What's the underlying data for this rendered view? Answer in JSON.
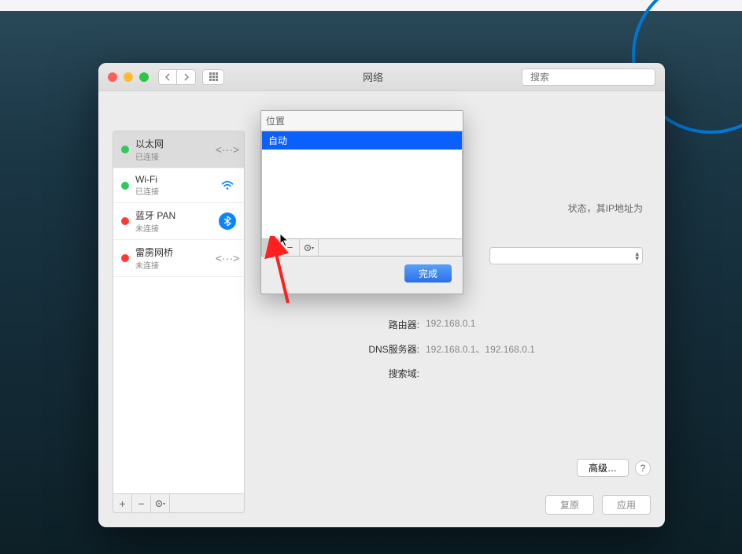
{
  "window": {
    "title": "网络",
    "search_placeholder": "搜索"
  },
  "sidebar": {
    "items": [
      {
        "name": "以太网",
        "status": "已连接",
        "dot": "green",
        "icon": "ethernet",
        "selected": true
      },
      {
        "name": "Wi-Fi",
        "status": "已连接",
        "dot": "green",
        "icon": "wifi",
        "selected": false
      },
      {
        "name": "蓝牙 PAN",
        "status": "未连接",
        "dot": "red",
        "icon": "bluetooth",
        "selected": false
      },
      {
        "name": "雷雳网桥",
        "status": "未连接",
        "dot": "red",
        "icon": "bridge",
        "selected": false
      }
    ]
  },
  "main": {
    "status_hint": "状态，其IP地址为",
    "router_label": "路由器:",
    "router_value": "192.168.0.1",
    "dns_label": "DNS服务器:",
    "dns_value": "192.168.0.1、192.168.0.1",
    "search_domain_label": "搜索域:",
    "advanced_button": "高级…",
    "revert_button": "复原",
    "apply_button": "应用"
  },
  "location_popup": {
    "label": "位置",
    "items": [
      {
        "name": "自动",
        "selected": true
      }
    ],
    "done_button": "完成"
  }
}
